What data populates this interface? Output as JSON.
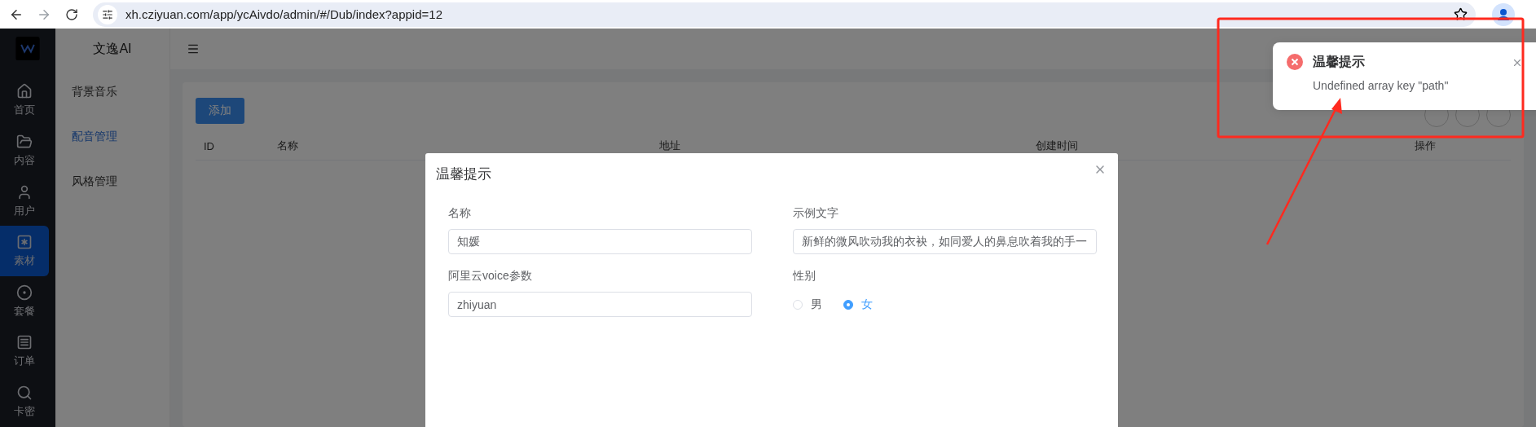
{
  "browser": {
    "url": "xh.cziyuan.com/app/ycAivdo/admin/#/Dub/index?appid=12"
  },
  "nav": {
    "items": [
      {
        "label": "首页",
        "selected": false
      },
      {
        "label": "内容",
        "selected": false
      },
      {
        "label": "用户",
        "selected": false
      },
      {
        "label": "素材",
        "selected": true
      },
      {
        "label": "套餐",
        "selected": false
      },
      {
        "label": "订单",
        "selected": false
      },
      {
        "label": "卡密",
        "selected": false
      }
    ]
  },
  "submenu": {
    "title": "文逸AI",
    "items": [
      {
        "label": "背景音乐",
        "selected": false
      },
      {
        "label": "配音管理",
        "selected": true
      },
      {
        "label": "风格管理",
        "selected": false
      }
    ]
  },
  "toolbar": {
    "add_button": "添加"
  },
  "table": {
    "columns": [
      "ID",
      "名称",
      "地址",
      "创建时间",
      "操作"
    ]
  },
  "dialog": {
    "title": "温馨提示",
    "fields": [
      {
        "kind": "text",
        "label": "名称",
        "value": "知媛"
      },
      {
        "kind": "text",
        "label": "示例文字",
        "value": "新鲜的微风吹动我的衣袂，如同爱人的鼻息吹着我的手一"
      },
      {
        "kind": "text",
        "label": "阿里云voice参数",
        "value": "zhiyuan"
      },
      {
        "kind": "radio",
        "label": "性别",
        "options": [
          {
            "label": "男",
            "selected": false
          },
          {
            "label": "女",
            "selected": true
          }
        ]
      }
    ]
  },
  "notification": {
    "title": "温馨提示",
    "message": "Undefined array key \"path\""
  }
}
